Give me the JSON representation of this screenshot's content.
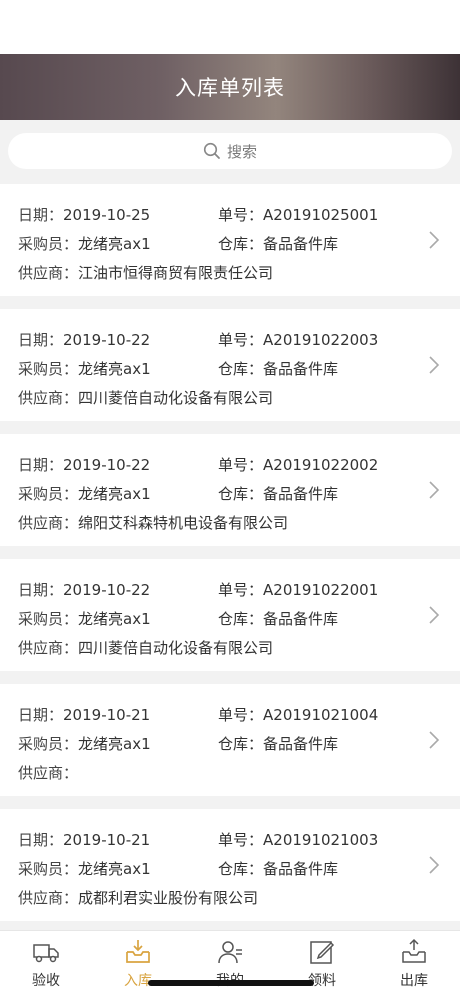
{
  "header": {
    "title": "入库单列表"
  },
  "search": {
    "placeholder": "搜索"
  },
  "labels": {
    "date": "日期：",
    "order_no": "单号：",
    "buyer": "采购员：",
    "warehouse": "仓库：",
    "supplier": "供应商："
  },
  "records": [
    {
      "date": "2019-10-25",
      "order_no": "A20191025001",
      "buyer": "龙绪亮ax1",
      "warehouse": "备品备件库",
      "supplier": "江油市恒得商贸有限责任公司"
    },
    {
      "date": "2019-10-22",
      "order_no": "A20191022003",
      "buyer": "龙绪亮ax1",
      "warehouse": "备品备件库",
      "supplier": "四川菱倍自动化设备有限公司"
    },
    {
      "date": "2019-10-22",
      "order_no": "A20191022002",
      "buyer": "龙绪亮ax1",
      "warehouse": "备品备件库",
      "supplier": "绵阳艾科森特机电设备有限公司"
    },
    {
      "date": "2019-10-22",
      "order_no": "A20191022001",
      "buyer": "龙绪亮ax1",
      "warehouse": "备品备件库",
      "supplier": "四川菱倍自动化设备有限公司"
    },
    {
      "date": "2019-10-21",
      "order_no": "A20191021004",
      "buyer": "龙绪亮ax1",
      "warehouse": "备品备件库",
      "supplier": ""
    },
    {
      "date": "2019-10-21",
      "order_no": "A20191021003",
      "buyer": "龙绪亮ax1",
      "warehouse": "备品备件库",
      "supplier": "成都利君实业股份有限公司"
    }
  ],
  "tabbar": {
    "items": [
      {
        "label": "验收",
        "icon": "truck-icon",
        "active": false
      },
      {
        "label": "入库",
        "icon": "inbox-download-icon",
        "active": true
      },
      {
        "label": "我的",
        "icon": "user-icon",
        "active": false
      },
      {
        "label": "领料",
        "icon": "edit-icon",
        "active": false
      },
      {
        "label": "出库",
        "icon": "outbox-upload-icon",
        "active": false
      }
    ]
  },
  "colors": {
    "active_tab": "#d9a441",
    "text": "#333333",
    "background": "#f2f2f2"
  }
}
